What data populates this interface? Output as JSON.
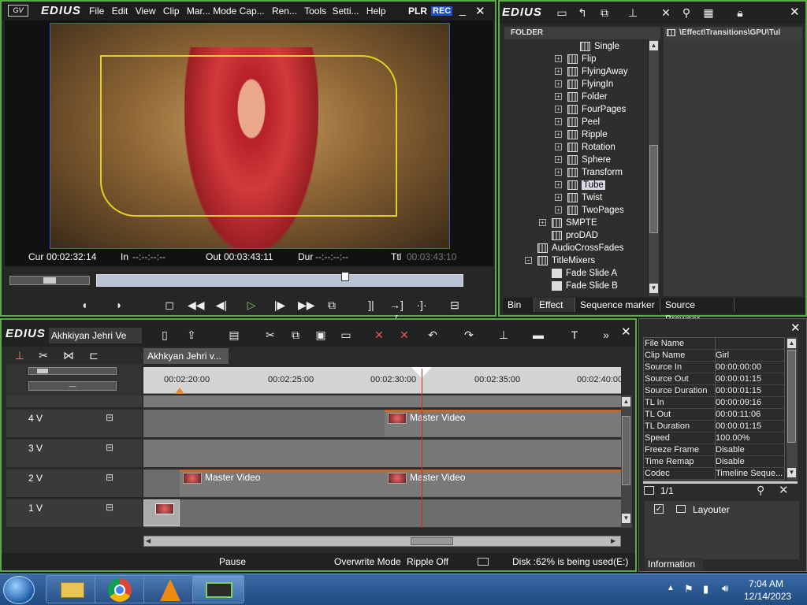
{
  "player": {
    "logo": "EDIUS",
    "menu": [
      "File",
      "Edit",
      "View",
      "Clip",
      "Mar...",
      "Mode",
      "Cap...",
      "Ren...",
      "Tools",
      "Setti...",
      "Help"
    ],
    "plr": "PLR",
    "rec": "REC",
    "cur_label": "Cur",
    "cur_value": "00:02:32:14",
    "in_label": "In",
    "in_value": "--:--:--:--",
    "out_label": "Out",
    "out_value": "00:03:43:11",
    "dur_label": "Dur",
    "dur_value": "--:--:--:--",
    "ttl_label": "Ttl",
    "ttl_value": "00:03:43:10"
  },
  "bin": {
    "logo": "EDIUS",
    "folder_header": "FOLDER",
    "path": "\\Effect\\Transitions\\GPU\\Tul",
    "tree": [
      "Single",
      "Flip",
      "FlyingAway",
      "FlyingIn",
      "Folder",
      "FourPages",
      "Peel",
      "Ripple",
      "Rotation",
      "Sphere",
      "Transform",
      "Tube",
      "Twist",
      "TwoPages"
    ],
    "tree_lower": [
      "SMPTE",
      "proDAD",
      "AudioCrossFades",
      "TitleMixers",
      "Fade Slide A",
      "Fade Slide B"
    ],
    "selected": "Tube",
    "tabs": [
      "Bin",
      "Effect",
      "Sequence marker",
      "Source Browser"
    ],
    "active_tab": "Effect"
  },
  "timeline": {
    "logo": "EDIUS",
    "project_name": "Akhkiyan Jehri Ve",
    "sequence_tab": "Akhkyan Jehri v...",
    "ruler": [
      "00:02:20:00",
      "00:02:25:00",
      "00:02:30:00",
      "00:02:35:00",
      "00:02:40:00"
    ],
    "tracks": [
      {
        "name": "4 V",
        "clips": [
          "Master Video"
        ]
      },
      {
        "name": "3 V",
        "clips": []
      },
      {
        "name": "2 V",
        "clips": [
          "Master Video",
          "Master Video"
        ]
      },
      {
        "name": "1 V",
        "clips": []
      }
    ]
  },
  "info": {
    "rows": [
      {
        "k": "File Name",
        "v": ""
      },
      {
        "k": "Clip Name",
        "v": "Girl"
      },
      {
        "k": "Source In",
        "v": "00:00:00:00"
      },
      {
        "k": "Source Out",
        "v": "00:00:01:15"
      },
      {
        "k": "Source Duration",
        "v": "00:00:01:15"
      },
      {
        "k": "TL In",
        "v": "00:00:09:16"
      },
      {
        "k": "TL Out",
        "v": "00:00:11:06"
      },
      {
        "k": "TL Duration",
        "v": "00:00:01:15"
      },
      {
        "k": "Speed",
        "v": "100.00%"
      },
      {
        "k": "Freeze Frame",
        "v": "Disable"
      },
      {
        "k": "Time Remap",
        "v": "Disable"
      },
      {
        "k": "Codec",
        "v": "Timeline Seque..."
      }
    ],
    "page": "1/1",
    "layouter": "Layouter",
    "tab": "Information"
  },
  "status": {
    "pause": "Pause",
    "mode": "Overwrite Mode",
    "ripple": "Ripple Off",
    "disk": "Disk :62% is being used(E:)"
  },
  "taskbar": {
    "time": "7:04 AM",
    "date": "12/14/2023"
  }
}
